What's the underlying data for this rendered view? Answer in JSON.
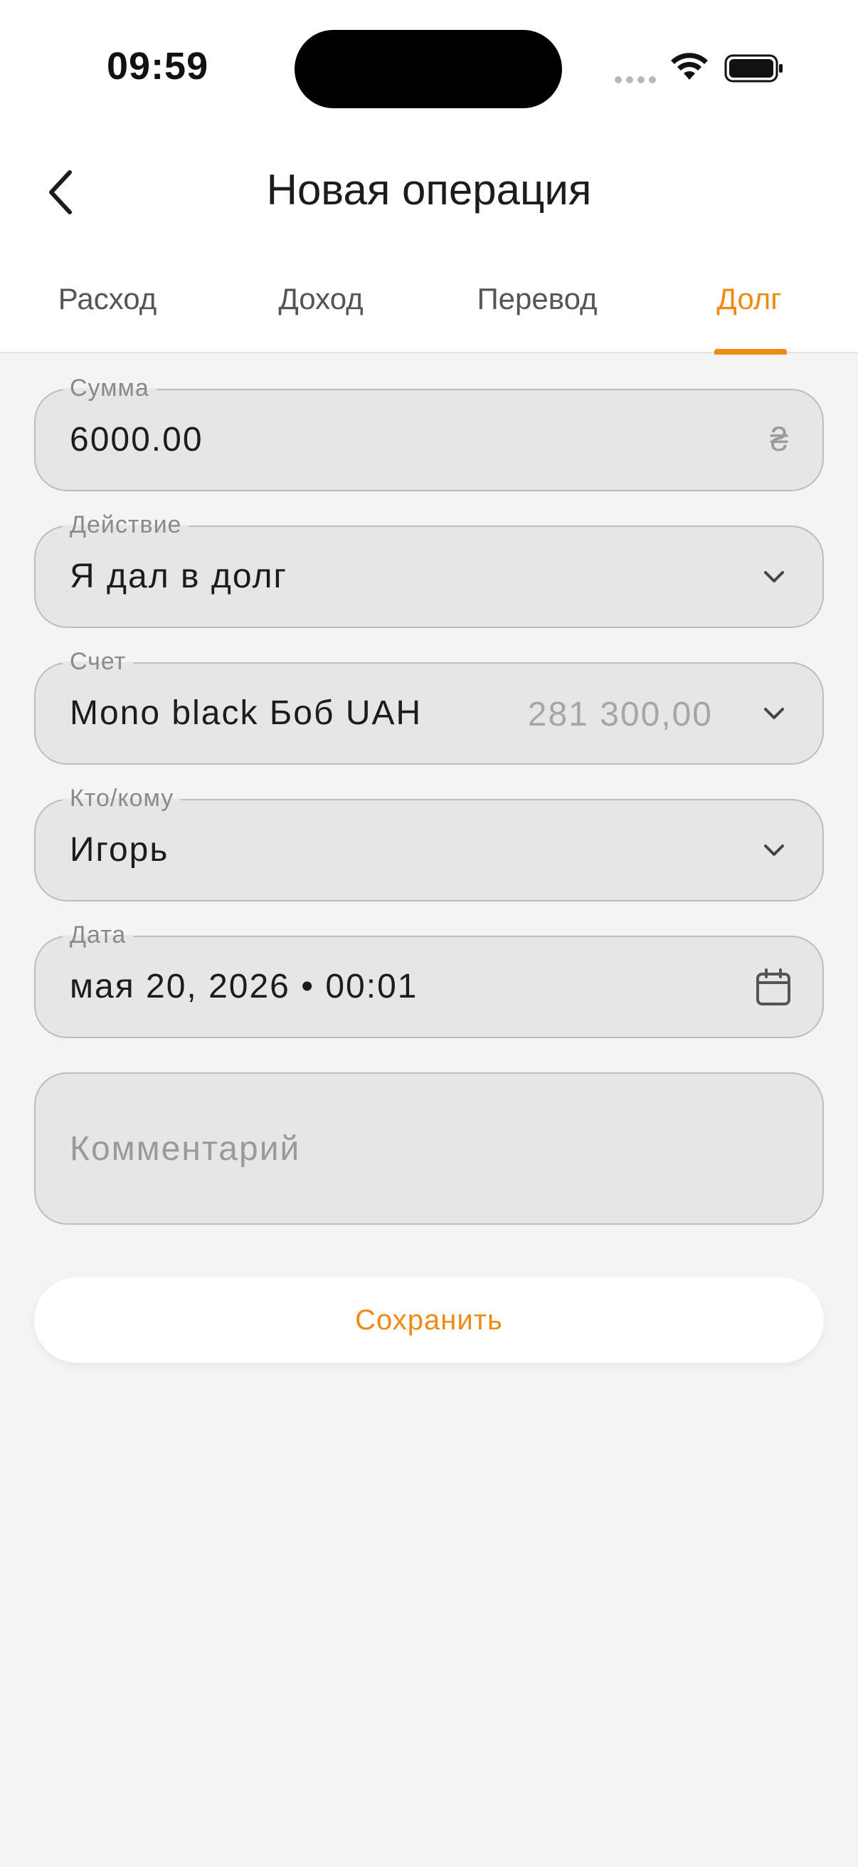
{
  "status_bar": {
    "time": "09:59"
  },
  "header": {
    "title": "Новая операция"
  },
  "tabs": [
    {
      "label": "Расход",
      "active": false
    },
    {
      "label": "Доход",
      "active": false
    },
    {
      "label": "Перевод",
      "active": false
    },
    {
      "label": "Долг",
      "active": true
    }
  ],
  "form": {
    "amount": {
      "label": "Сумма",
      "value": "6000.00",
      "currency": "₴"
    },
    "action": {
      "label": "Действие",
      "value": "Я дал в долг"
    },
    "account": {
      "label": "Счет",
      "value": "Mono black Боб UAH",
      "balance": "281 300,00"
    },
    "counterparty": {
      "label": "Кто/кому",
      "value": "Игорь"
    },
    "date": {
      "label": "Дата",
      "value": "мая 20, 2026 • 00:01"
    },
    "comment": {
      "placeholder": "Комментарий"
    }
  },
  "save_label": "Сохранить",
  "colors": {
    "accent": "#f08a14",
    "field_bg": "#e6e6e6",
    "page_bg": "#f4f4f4"
  }
}
